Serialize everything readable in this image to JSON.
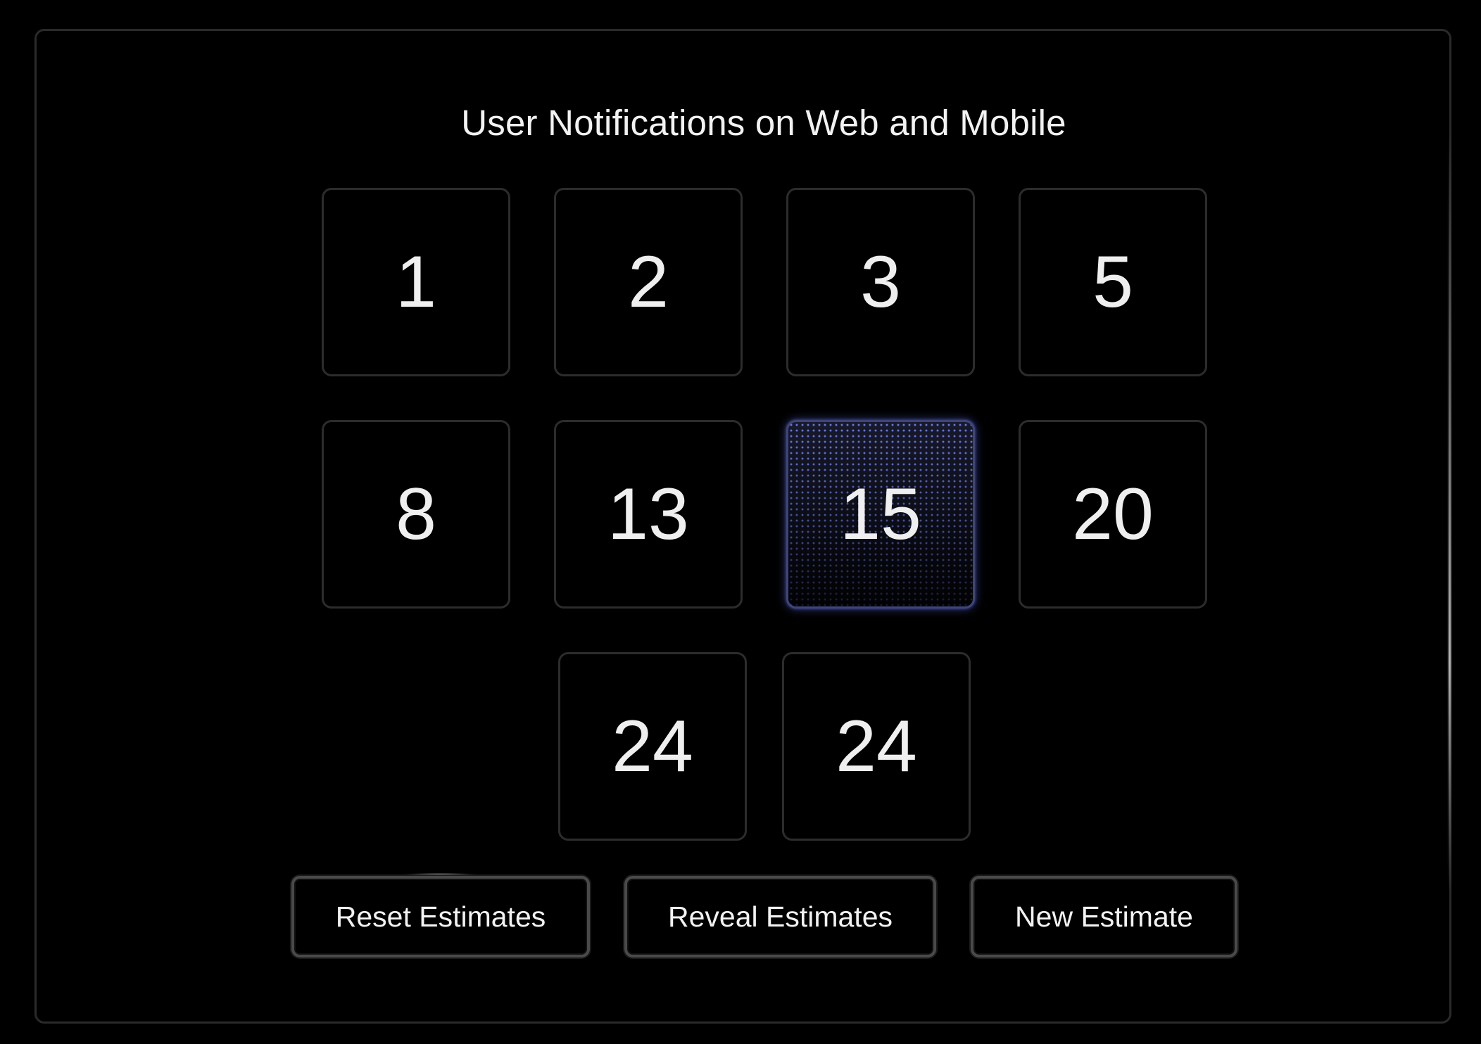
{
  "estimate": {
    "title": "User Notifications on Web and Mobile"
  },
  "cards": [
    {
      "value": "1"
    },
    {
      "value": "2"
    },
    {
      "value": "3"
    },
    {
      "value": "5"
    },
    {
      "value": "8"
    },
    {
      "value": "13"
    },
    {
      "value": "15",
      "selected": true
    },
    {
      "value": "20"
    },
    {
      "value": "24"
    },
    {
      "value": "24"
    }
  ],
  "actions": {
    "reset_label": "Reset Estimates",
    "reveal_label": "Reveal Estimates",
    "new_label": "New Estimate"
  },
  "colors": {
    "background": "#000000",
    "card_border": "#2c2c2c",
    "selected_accent": "#5a64dc",
    "text": "#efefef"
  }
}
